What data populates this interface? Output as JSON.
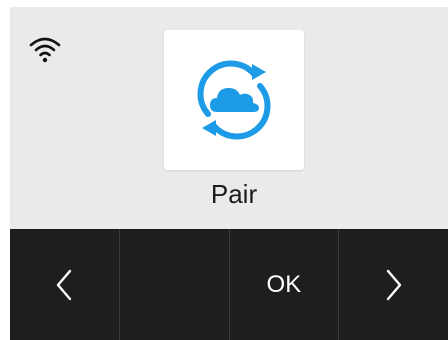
{
  "status": {
    "wifi_icon": "wifi-icon"
  },
  "tile": {
    "icon": "cloud-sync-icon",
    "accent_color": "#1e9be6"
  },
  "label": "Pair",
  "nav": {
    "back_icon": "chevron-left-icon",
    "blank": "",
    "ok_label": "OK",
    "next_icon": "chevron-right-icon"
  },
  "colors": {
    "background": "#eaeaea",
    "nav_bar": "#1e1e1e",
    "accent": "#1e9be6"
  }
}
